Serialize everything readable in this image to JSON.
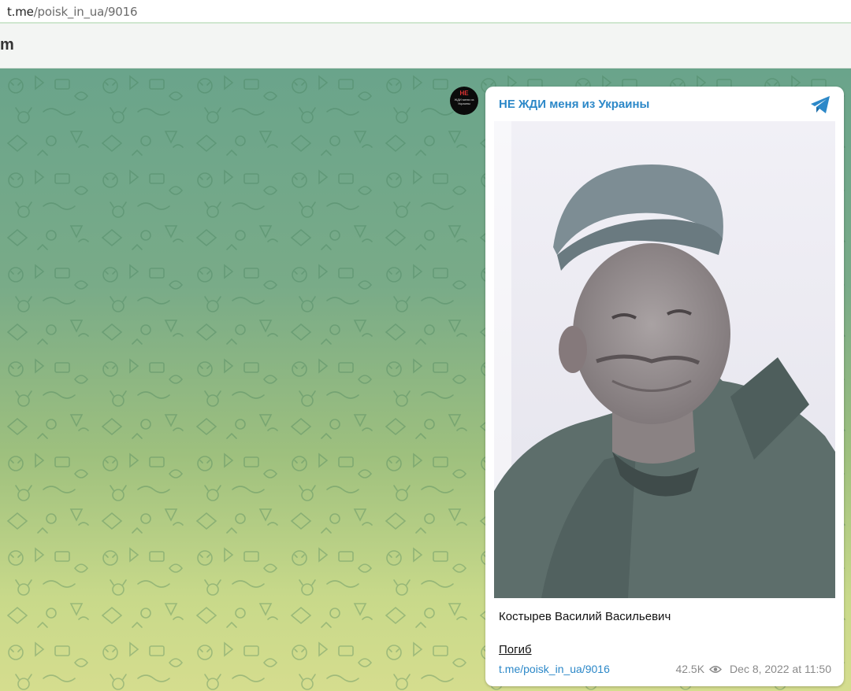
{
  "browser": {
    "url_host": "t.me",
    "url_path": "/poisk_in_ua/9016"
  },
  "header": {
    "logo_partial": "m"
  },
  "channel": {
    "avatar_text_top": "НЕ",
    "avatar_text_sub": "ЖДИ меня из Украины",
    "name": "НЕ ЖДИ меня из Украины"
  },
  "post": {
    "caption_name": "Костырев Василий Васильевич",
    "status": "Погиб",
    "link": "t.me/poisk_in_ua/9016",
    "views": "42.5K",
    "datetime": "Dec 8, 2022 at 11:50"
  },
  "icons": {
    "telegram": "telegram-plane-icon",
    "views": "eye-icon"
  },
  "colors": {
    "accent": "#2c88c8",
    "bg_top": "#6aa48b",
    "bg_bottom": "#d5dd8e"
  }
}
